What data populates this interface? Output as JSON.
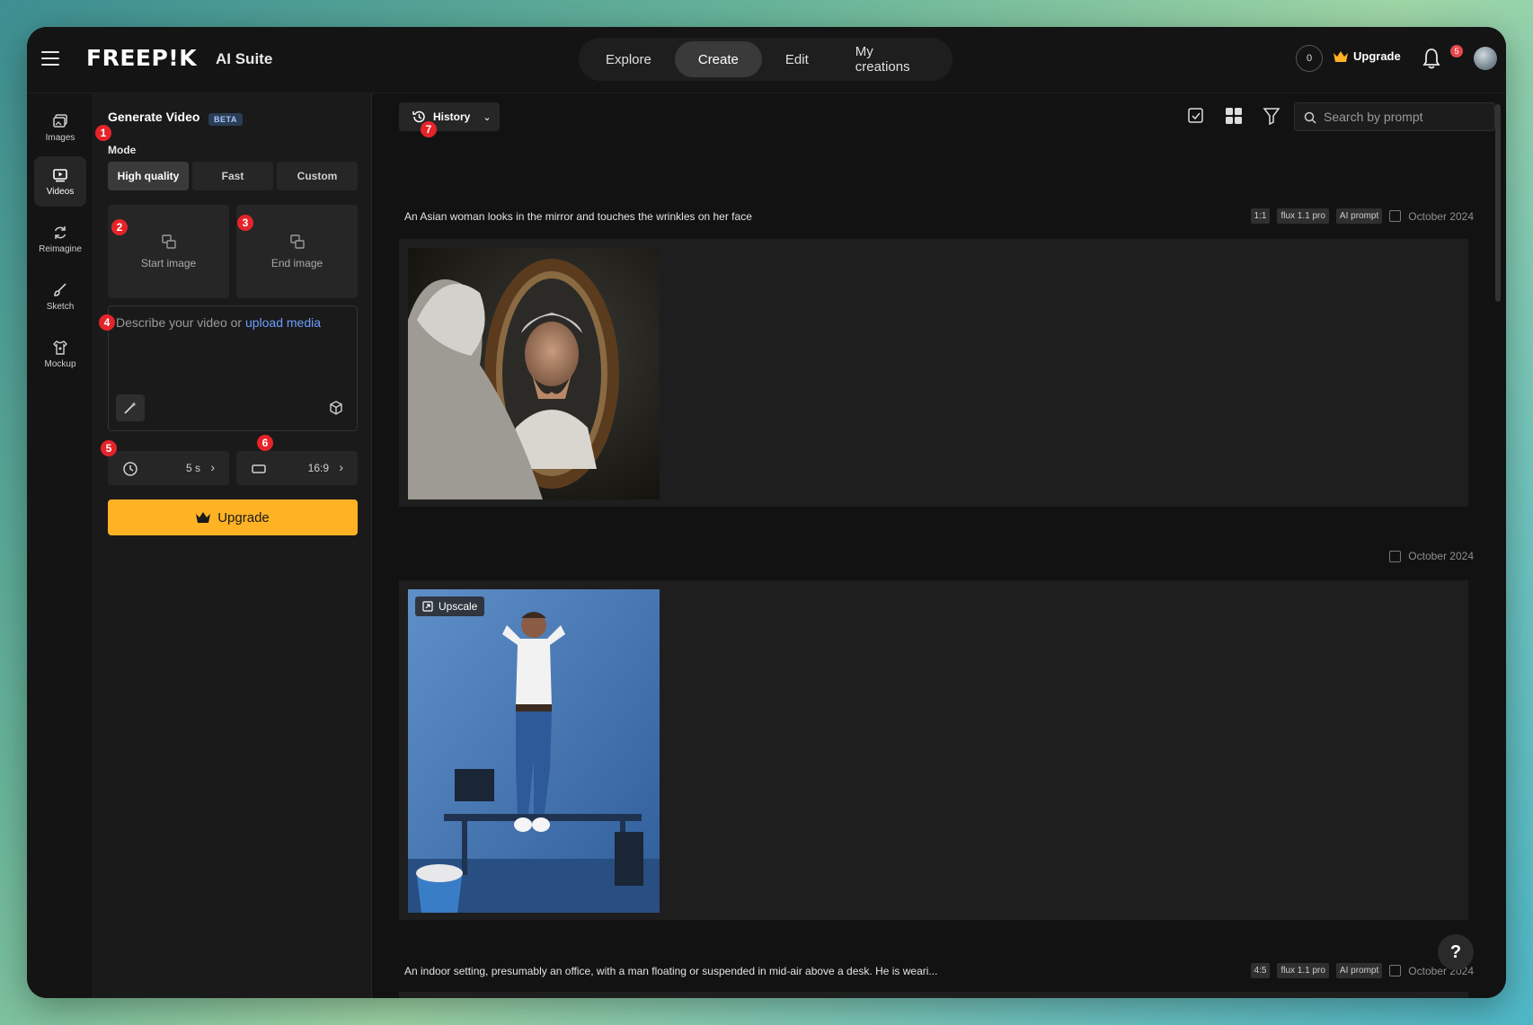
{
  "header": {
    "brand": "FREEP!K",
    "suite": "AI Suite",
    "nav_tabs": [
      "Explore",
      "Create",
      "Edit",
      "My creations"
    ],
    "active_tab": "Create",
    "credits": "0",
    "upgrade": "Upgrade",
    "notification_count": "5"
  },
  "rail": {
    "items": [
      {
        "label": "Images",
        "icon": "images-icon"
      },
      {
        "label": "Videos",
        "icon": "video-icon"
      },
      {
        "label": "Reimagine",
        "icon": "refresh-icon"
      },
      {
        "label": "Sketch",
        "icon": "brush-icon"
      },
      {
        "label": "Mockup",
        "icon": "mockup-icon"
      }
    ],
    "active": "Videos"
  },
  "panel": {
    "title": "Generate Video",
    "beta": "BETA",
    "mode_label": "Mode",
    "modes": [
      "High quality",
      "Fast",
      "Custom"
    ],
    "active_mode": "High quality",
    "start_image": "Start image",
    "end_image": "End image",
    "prompt_placeholder": "Describe your video or",
    "prompt_link": "upload media",
    "duration": "5 s",
    "aspect": "16:9",
    "upgrade": "Upgrade"
  },
  "badges": [
    "1",
    "2",
    "3",
    "4",
    "5",
    "6",
    "7"
  ],
  "toolbar": {
    "history": "History",
    "search_placeholder": "Search by prompt"
  },
  "entries": [
    {
      "desc": "An Asian woman looks in the mirror and touches the wrinkles on her face",
      "tags": [
        "1:1",
        "flux 1.1 pro",
        "AI prompt"
      ],
      "date": "October 2024"
    },
    {
      "desc": "",
      "tags": [],
      "date": "October 2024",
      "overlay": "Upscale"
    },
    {
      "desc": "An indoor setting, presumably an office, with a man floating or suspended in mid-air above a desk. He is weari...",
      "tags": [
        "4:5",
        "flux 1.1 pro",
        "AI prompt"
      ],
      "date": "October 2024"
    }
  ],
  "help": "?",
  "colors": {
    "accent": "#ffb224",
    "link": "#6f9dff",
    "badge": "#e5242a",
    "background": "#121212"
  }
}
